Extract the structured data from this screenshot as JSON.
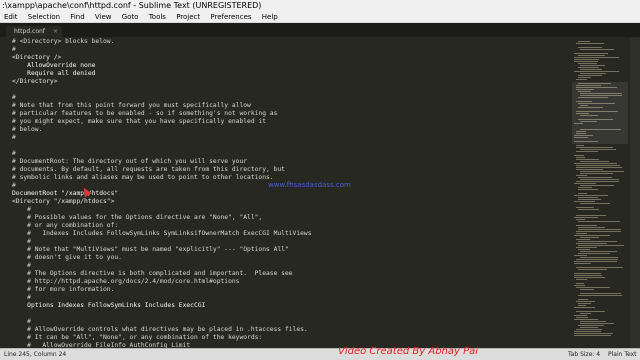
{
  "window": {
    "title": ":\\xampp\\apache\\conf\\httpd.conf - Sublime Text (UNREGISTERED)"
  },
  "menu": {
    "items": [
      "Edit",
      "Selection",
      "Find",
      "View",
      "Goto",
      "Tools",
      "Project",
      "Preferences",
      "Help"
    ]
  },
  "tabs": [
    {
      "label": "httpd.conf",
      "close_glyph": "×",
      "active": true
    }
  ],
  "editor": {
    "lines": [
      "# <Directory> blocks below.",
      "#",
      "<Directory />",
      "    AllowOverride none",
      "    Require all denied",
      "</Directory>",
      "",
      "#",
      "# Note that from this point forward you must specifically allow",
      "# particular features to be enabled - so if something's not working as",
      "# you might expect, make sure that you have specifically enabled it",
      "# below.",
      "#",
      "",
      "#",
      "# DocumentRoot: The directory out of which you will serve your",
      "# documents. By default, all requests are taken from this directory, but",
      "# symbolic links and aliases may be used to point to other locations.",
      "#",
      "DocumentRoot \"/xampp/htdocs\"",
      "<Directory \"/xampp/htdocs\">",
      "    #",
      "    # Possible values for the Options directive are \"None\", \"All\",",
      "    # or any combination of:",
      "    #   Indexes Includes FollowSymLinks SymLinksifOwnerMatch ExecCGI MultiViews",
      "    #",
      "    # Note that \"MultiViews\" must be named \"explicitly\" --- \"Options All\"",
      "    # doesn't give it to you.",
      "    #",
      "    # The Options directive is both complicated and important.  Please see",
      "    # http://httpd.apache.org/docs/2.4/mod/core.html#options",
      "    # for more information.",
      "    #",
      "    Options Indexes FollowSymLinks Includes ExecCGI",
      "",
      "    #",
      "    # AllowOverride controls what directives may be placed in .htaccess files.",
      "    # It can be \"All\", \"None\", or any combination of the keywords:",
      "    #   AllowOverride FileInfo AuthConfig Limit",
      "    #",
      "    AllowOverride All"
    ]
  },
  "status": {
    "cursor": "Line 245, Column 24",
    "tab_size": "Tab Size: 4",
    "syntax": "Plain Text"
  },
  "overlay": {
    "watermark_top": "www.fhsasdasdass.com",
    "watermark_bottom": "Video Created By Abhay Pai"
  },
  "colors": {
    "editor_bg": "#272822",
    "text": "#f8f8f2",
    "watermark_red": "#e8201c",
    "watermark_blue": "#4a5fd8"
  }
}
